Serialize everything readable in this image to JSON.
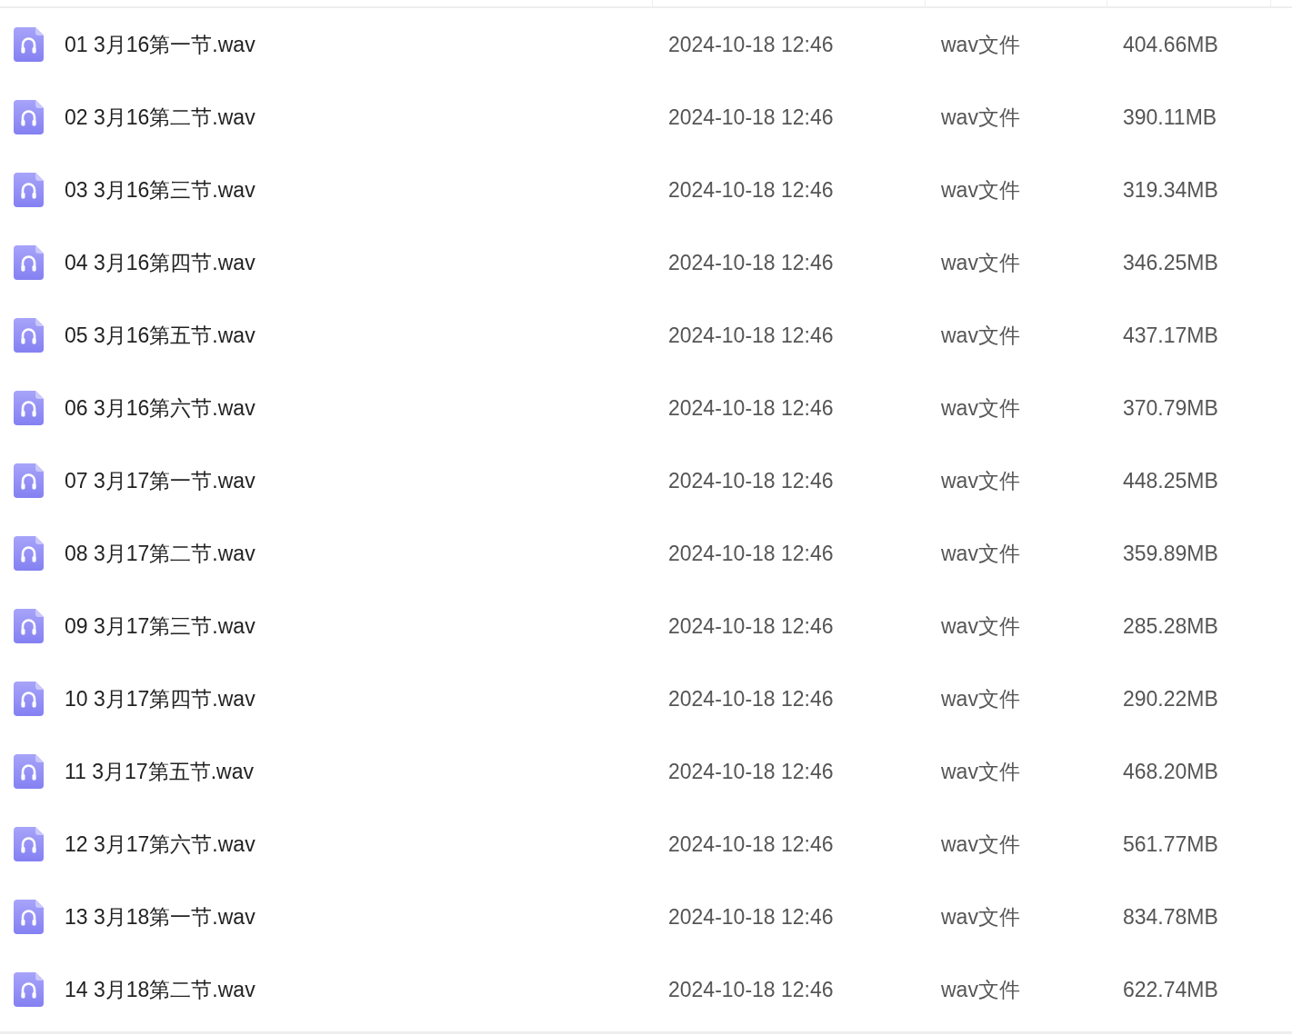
{
  "files": [
    {
      "name": "01 3月16第一节.wav",
      "modified": "2024-10-18 12:46",
      "type": "wav文件",
      "size": "404.66MB"
    },
    {
      "name": "02 3月16第二节.wav",
      "modified": "2024-10-18 12:46",
      "type": "wav文件",
      "size": "390.11MB"
    },
    {
      "name": "03 3月16第三节.wav",
      "modified": "2024-10-18 12:46",
      "type": "wav文件",
      "size": "319.34MB"
    },
    {
      "name": "04 3月16第四节.wav",
      "modified": "2024-10-18 12:46",
      "type": "wav文件",
      "size": "346.25MB"
    },
    {
      "name": "05 3月16第五节.wav",
      "modified": "2024-10-18 12:46",
      "type": "wav文件",
      "size": "437.17MB"
    },
    {
      "name": "06 3月16第六节.wav",
      "modified": "2024-10-18 12:46",
      "type": "wav文件",
      "size": "370.79MB"
    },
    {
      "name": "07 3月17第一节.wav",
      "modified": "2024-10-18 12:46",
      "type": "wav文件",
      "size": "448.25MB"
    },
    {
      "name": "08 3月17第二节.wav",
      "modified": "2024-10-18 12:46",
      "type": "wav文件",
      "size": "359.89MB"
    },
    {
      "name": "09 3月17第三节.wav",
      "modified": "2024-10-18 12:46",
      "type": "wav文件",
      "size": "285.28MB"
    },
    {
      "name": "10 3月17第四节.wav",
      "modified": "2024-10-18 12:46",
      "type": "wav文件",
      "size": "290.22MB"
    },
    {
      "name": "11 3月17第五节.wav",
      "modified": "2024-10-18 12:46",
      "type": "wav文件",
      "size": "468.20MB"
    },
    {
      "name": "12 3月17第六节.wav",
      "modified": "2024-10-18 12:46",
      "type": "wav文件",
      "size": "561.77MB"
    },
    {
      "name": "13 3月18第一节.wav",
      "modified": "2024-10-18 12:46",
      "type": "wav文件",
      "size": "834.78MB"
    },
    {
      "name": "14 3月18第二节.wav",
      "modified": "2024-10-18 12:46",
      "type": "wav文件",
      "size": "622.74MB"
    }
  ]
}
